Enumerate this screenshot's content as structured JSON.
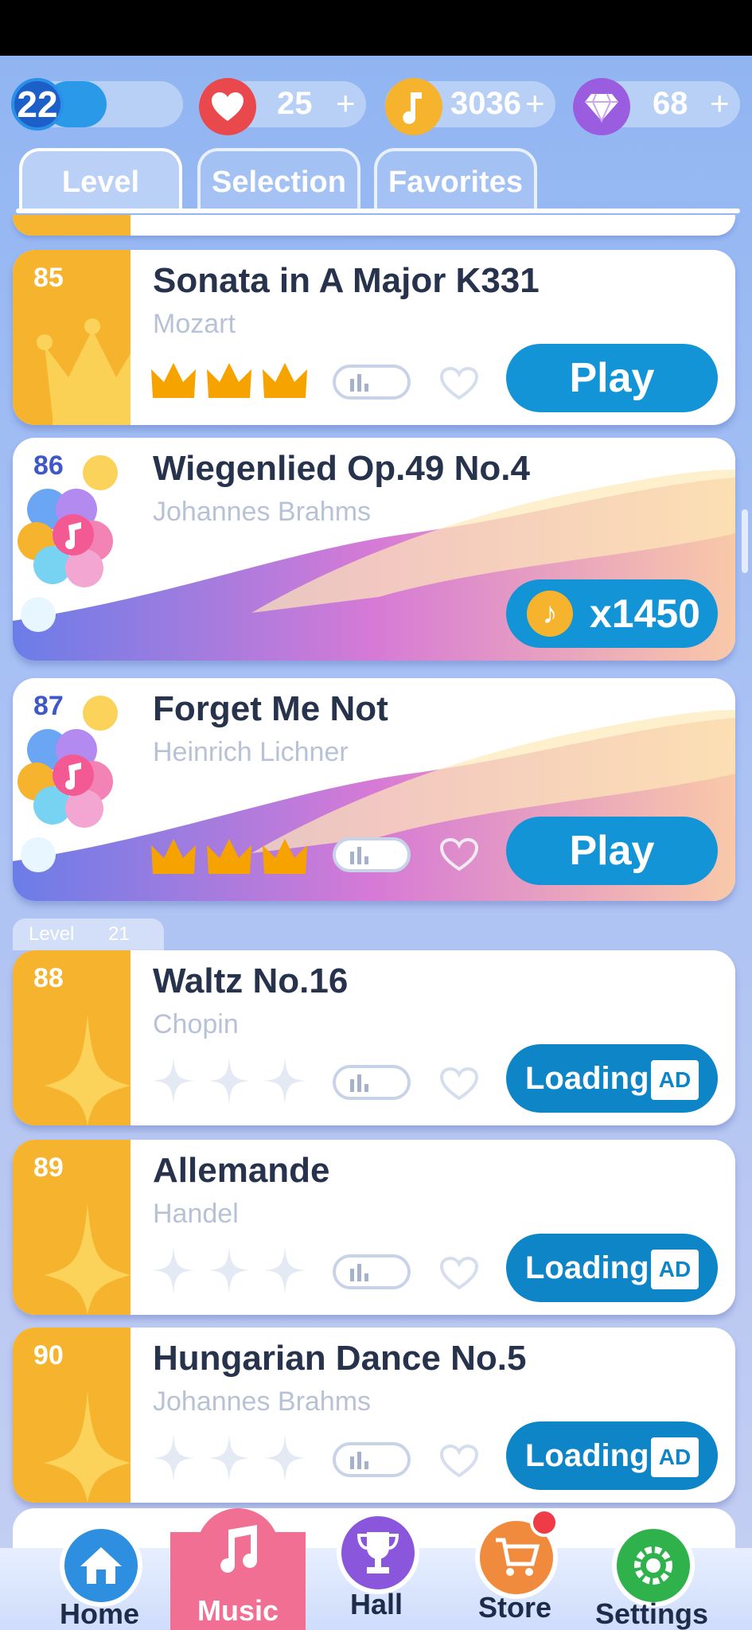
{
  "topbar": {
    "level": "22",
    "lives": "25",
    "coins": "3036",
    "diamonds": "68",
    "plus": "+"
  },
  "tabs": [
    {
      "label": "Level",
      "active": true
    },
    {
      "label": "Selection",
      "active": false
    },
    {
      "label": "Favorites",
      "active": false
    }
  ],
  "songs": [
    {
      "num": "85",
      "title": "Sonata in A Major K331",
      "composer": "Mozart",
      "stars": 3,
      "action": "Play"
    },
    {
      "num": "86",
      "title": "Wiegenlied Op.49 No.4",
      "composer": "Johannes Brahms",
      "stars": 0,
      "action": "x1450"
    },
    {
      "num": "87",
      "title": "Forget Me Not",
      "composer": "Heinrich Lichner",
      "stars": 3,
      "action": "Play"
    },
    {
      "num": "88",
      "title": "Waltz No.16",
      "composer": "Chopin",
      "stars": 0,
      "action": "Loading..."
    },
    {
      "num": "89",
      "title": "Allemande",
      "composer": "Handel",
      "stars": 0,
      "action": "Loading..."
    },
    {
      "num": "90",
      "title": "Hungarian Dance No.5",
      "composer": "Johannes Brahms",
      "stars": 0,
      "action": "Loading..."
    }
  ],
  "level_header": {
    "label": "Level",
    "value": "21"
  },
  "ad_label": "AD",
  "nav": [
    {
      "label": "Home"
    },
    {
      "label": "Music"
    },
    {
      "label": "Hall"
    },
    {
      "label": "Store"
    },
    {
      "label": "Settings"
    }
  ],
  "colors": {
    "orange": "#f6b32e",
    "button_blue": "#1294d6",
    "title": "#27324c",
    "nav_active": "#f06f92"
  }
}
